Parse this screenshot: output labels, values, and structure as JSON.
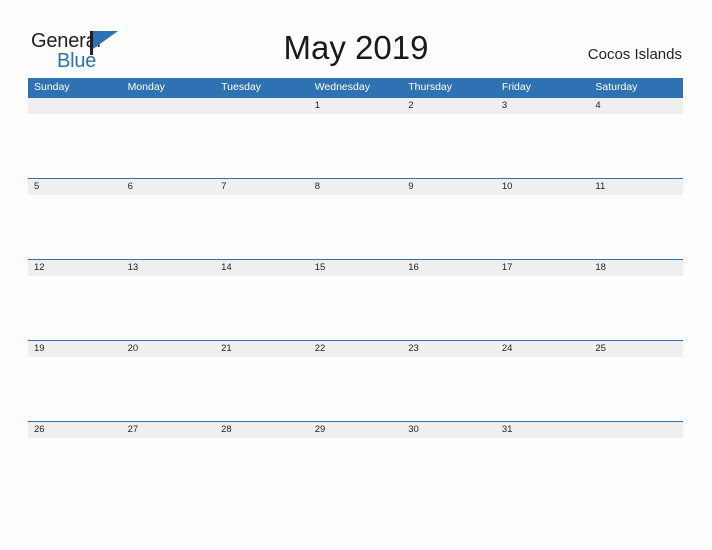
{
  "brand": {
    "name_part1": "General",
    "name_part2": "Blue",
    "flag_icon": "flag-triangle-icon",
    "accent_color": "#2e72b4",
    "text_color": "#231f20"
  },
  "header": {
    "title": "May 2019",
    "location": "Cocos Islands"
  },
  "calendar": {
    "month": "May",
    "year": "2019",
    "header_bg": "#2e72b4",
    "date_band_bg": "#efefef",
    "date_band_border": "#2e72b4",
    "weekdays": [
      "Sunday",
      "Monday",
      "Tuesday",
      "Wednesday",
      "Thursday",
      "Friday",
      "Saturday"
    ],
    "weeks": [
      {
        "days": [
          {
            "date": ""
          },
          {
            "date": ""
          },
          {
            "date": ""
          },
          {
            "date": "1"
          },
          {
            "date": "2"
          },
          {
            "date": "3"
          },
          {
            "date": "4"
          }
        ]
      },
      {
        "days": [
          {
            "date": "5"
          },
          {
            "date": "6"
          },
          {
            "date": "7"
          },
          {
            "date": "8"
          },
          {
            "date": "9"
          },
          {
            "date": "10"
          },
          {
            "date": "11"
          }
        ]
      },
      {
        "days": [
          {
            "date": "12"
          },
          {
            "date": "13"
          },
          {
            "date": "14"
          },
          {
            "date": "15"
          },
          {
            "date": "16"
          },
          {
            "date": "17"
          },
          {
            "date": "18"
          }
        ]
      },
      {
        "days": [
          {
            "date": "19"
          },
          {
            "date": "20"
          },
          {
            "date": "21"
          },
          {
            "date": "22"
          },
          {
            "date": "23"
          },
          {
            "date": "24"
          },
          {
            "date": "25"
          }
        ]
      },
      {
        "days": [
          {
            "date": "26"
          },
          {
            "date": "27"
          },
          {
            "date": "28"
          },
          {
            "date": "29"
          },
          {
            "date": "30"
          },
          {
            "date": "31"
          },
          {
            "date": ""
          }
        ]
      }
    ]
  }
}
